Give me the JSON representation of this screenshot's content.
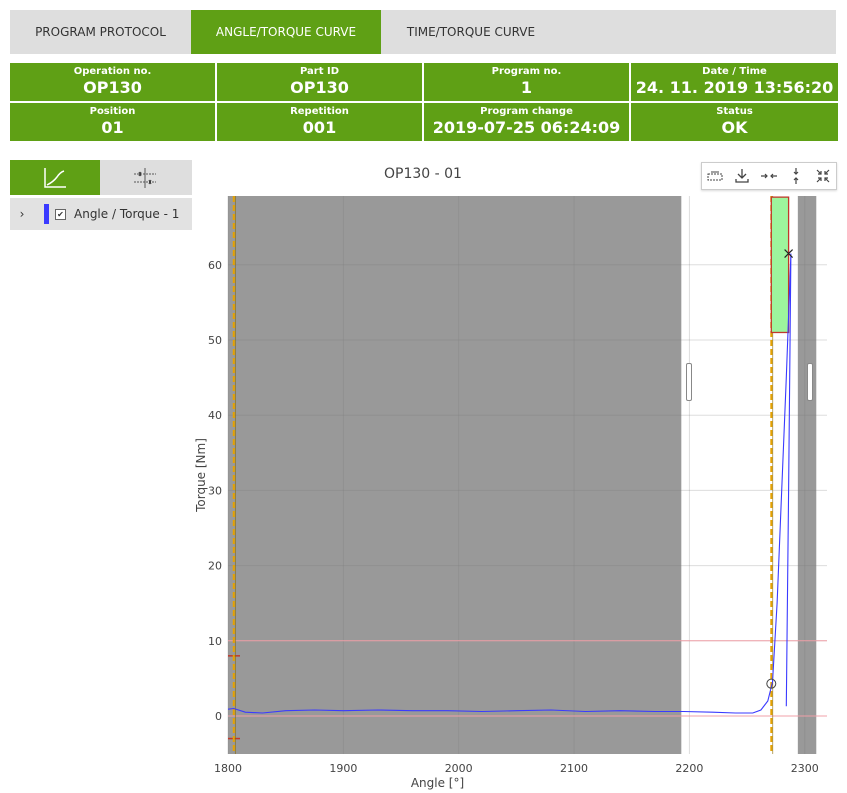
{
  "tabs": [
    {
      "label": "PROGRAM PROTOCOL"
    },
    {
      "label": "ANGLE/TORQUE CURVE"
    },
    {
      "label": "TIME/TORQUE CURVE"
    }
  ],
  "info": [
    {
      "label": "Operation no.",
      "value": "OP130"
    },
    {
      "label": "Part ID",
      "value": "OP130"
    },
    {
      "label": "Program no.",
      "value": "1"
    },
    {
      "label": "Date / Time",
      "value": "24. 11. 2019 13:56:20"
    },
    {
      "label": "Position",
      "value": "01"
    },
    {
      "label": "Repetition",
      "value": "001"
    },
    {
      "label": "Program change",
      "value": "2019-07-25 06:24:09"
    },
    {
      "label": "Status",
      "value": "OK"
    }
  ],
  "left_panel": {
    "series_item": {
      "label": "Angle / Torque - 1",
      "checked": "✔"
    }
  },
  "icons": {
    "chart": "line-chart-icon",
    "markers": "markers-icon",
    "toolbar": [
      "box-select-icon",
      "download-icon",
      "zoom-horizontal-icon",
      "zoom-vertical-icon",
      "reset-zoom-icon"
    ]
  },
  "colors": {
    "accent": "#5fa015",
    "series": "#3a3aff",
    "gray_region": "#999999",
    "window": "#c0392b",
    "window_fill": "#9df59d",
    "marker_line": "#e6a200"
  },
  "chart_data": {
    "type": "line",
    "title": "OP130 - 01",
    "xlabel": "Angle [°]",
    "ylabel": "Torque [Nm]",
    "xlim": [
      1800,
      2305
    ],
    "ylim": [
      -5,
      69
    ],
    "xticks": [
      1800,
      1900,
      2000,
      2100,
      2200,
      2300
    ],
    "yticks": [
      0,
      10,
      20,
      30,
      40,
      50,
      60
    ],
    "grid": true,
    "series": [
      {
        "x": [
          1800,
          1805,
          1815,
          1830,
          1850,
          1875,
          1900,
          1930,
          1960,
          1990,
          2020,
          2050,
          2080,
          2110,
          2140,
          2170,
          2195,
          2220,
          2240,
          2255,
          2262,
          2268,
          2272,
          2276,
          2280,
          2284,
          2288,
          2286,
          2284
        ],
        "y": [
          0.9,
          1.0,
          0.5,
          0.4,
          0.7,
          0.8,
          0.7,
          0.8,
          0.7,
          0.7,
          0.6,
          0.7,
          0.8,
          0.6,
          0.7,
          0.6,
          0.6,
          0.5,
          0.4,
          0.4,
          0.8,
          2.0,
          4.5,
          15,
          30,
          45,
          61.5,
          30,
          1.3
        ]
      }
    ],
    "gray_regions": [
      [
        1795,
        2193
      ],
      [
        2294,
        2310
      ]
    ],
    "limit_lines": [
      10,
      0
    ],
    "vertical_markers": [
      1805,
      2271
    ],
    "torque_window": {
      "x": [
        2271,
        2286
      ],
      "y": [
        51,
        69
      ]
    },
    "left_limit_marks": [
      8,
      -3
    ],
    "start_point": {
      "x": 2271,
      "y": 4.3
    },
    "end_point": {
      "x": 2286,
      "y": 61.5
    }
  }
}
